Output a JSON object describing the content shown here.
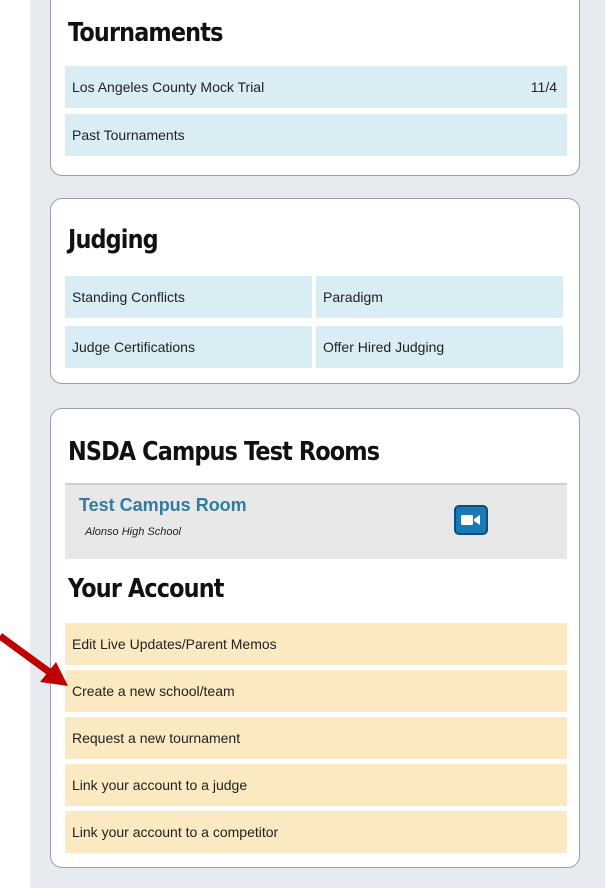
{
  "tournaments": {
    "title": "Tournaments",
    "items": [
      {
        "label": "Los Angeles County Mock Trial",
        "value": "11/4"
      },
      {
        "label": "Past Tournaments"
      }
    ]
  },
  "judging": {
    "title": "Judging",
    "items": [
      {
        "label": "Standing Conflicts"
      },
      {
        "label": "Paradigm"
      },
      {
        "label": "Judge Certifications"
      },
      {
        "label": "Offer Hired Judging"
      }
    ]
  },
  "campus": {
    "title": "NSDA Campus Test Rooms",
    "room_name": "Test Campus Room",
    "school": "Alonso High School",
    "join_icon": "video-camera-icon"
  },
  "account": {
    "title": "Your Account",
    "items": [
      {
        "label": "Edit Live Updates/Parent Memos"
      },
      {
        "label": "Create a new school/team"
      },
      {
        "label": "Request a new tournament"
      },
      {
        "label": "Link your account to a judge"
      },
      {
        "label": "Link your account to a competitor"
      }
    ]
  },
  "colors": {
    "accent": "#2f7ea0",
    "blue_row": "#daedf4",
    "yellow_row": "#fbe9c1",
    "annotation_arrow": "#c00000"
  }
}
